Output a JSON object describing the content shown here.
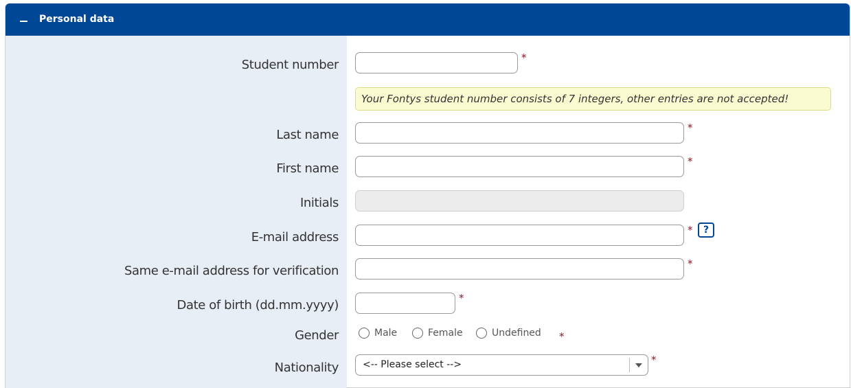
{
  "panel": {
    "title": "Personal data",
    "collapse_icon": "minus-icon"
  },
  "form": {
    "student_number": {
      "label": "Student number",
      "value": "",
      "required": "*"
    },
    "student_hint": "Your Fontys student number consists of 7 integers, other entries are not accepted!",
    "last_name": {
      "label": "Last name",
      "value": "",
      "required": "*"
    },
    "first_name": {
      "label": "First name",
      "value": "",
      "required": "*"
    },
    "initials": {
      "label": "Initials",
      "value": ""
    },
    "email": {
      "label": "E-mail address",
      "value": "",
      "required": "*",
      "help": "?"
    },
    "email_verify": {
      "label": "Same e-mail address for verification",
      "value": "",
      "required": "*"
    },
    "dob": {
      "label": "Date of birth (dd.mm.yyyy)",
      "value": "",
      "required": "*"
    },
    "gender": {
      "label": "Gender",
      "options": [
        "Male",
        "Female",
        "Undefined"
      ],
      "required": "*"
    },
    "nationality": {
      "label": "Nationality",
      "selected": "<-- Please select -->",
      "required": "*"
    }
  },
  "colors": {
    "header_bg": "#004795",
    "label_bg": "#e8eef6",
    "required": "#8b1a2a",
    "hint_bg": "#fbfbd2"
  }
}
